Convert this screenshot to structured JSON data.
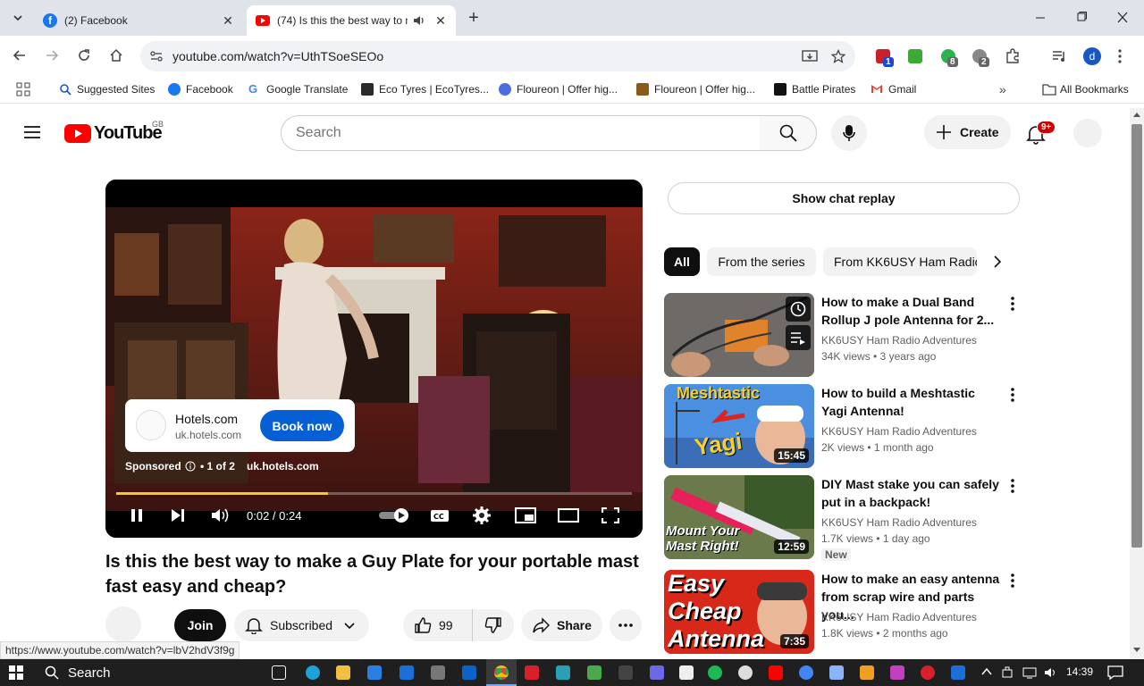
{
  "browser": {
    "tabs": [
      {
        "title": "(2) Facebook",
        "active": false
      },
      {
        "title": "(74) Is this the best way to m",
        "active": true
      }
    ],
    "url": "youtube.com/watch?v=UthTSoeSEOo",
    "extension_badges": [
      "1",
      "8",
      "2"
    ],
    "profile_initial": "d",
    "bookmarks": [
      "Suggested Sites",
      "Facebook",
      "Google Translate",
      "Eco Tyres | EcoTyres...",
      "Floureon | Offer hig...",
      "Floureon | Offer hig...",
      "Battle Pirates",
      "Gmail"
    ],
    "all_bookmarks": "All Bookmarks"
  },
  "yt": {
    "logo_text": "YouTube",
    "region": "GB",
    "search_placeholder": "Search",
    "create_label": "Create",
    "notif_badge": "9+"
  },
  "player": {
    "ad_advertiser": "Hotels.com",
    "ad_domain": "uk.hotels.com",
    "ad_cta": "Book now",
    "sponsored_label": "Sponsored",
    "ad_count": "• 1 of 2",
    "ad_link": "uk.hotels.com",
    "time": "0:02 / 0:24",
    "progress": 0.41
  },
  "video": {
    "title": "Is this the best way to make a Guy Plate for your portable mast fast easy and cheap?",
    "join_label": "Join",
    "subscribed_label": "Subscribed",
    "likes": "99",
    "share_label": "Share"
  },
  "sidebar": {
    "chat_replay": "Show chat replay",
    "chips": [
      "All",
      "From the series",
      "From KK6USY Ham Radio"
    ],
    "recommendations": [
      {
        "title": "How to make a Dual Band Rollup J pole Antenna for 2...",
        "channel": "KK6USY Ham Radio Adventures",
        "meta": "34K views • 3 years ago",
        "duration": "",
        "badge": ""
      },
      {
        "title": "How to build a Meshtastic Yagi Antenna!",
        "channel": "KK6USY Ham Radio Adventures",
        "meta": "2K views • 1 month ago",
        "duration": "15:45",
        "badge": "",
        "thumb_text": [
          "Meshtastic",
          "Yagi"
        ]
      },
      {
        "title": "DIY Mast stake you can safely put in a backpack!",
        "channel": "KK6USY Ham Radio Adventures",
        "meta": "1.7K views • 1 day ago",
        "duration": "12:59",
        "badge": "New",
        "thumb_text": [
          "Mount Your",
          "Mast Right!"
        ]
      },
      {
        "title": "How to make an easy antenna from scrap wire and parts you...",
        "channel": "KK6USY Ham Radio Adventures",
        "meta": "1.8K views • 2 months ago",
        "duration": "7:35",
        "badge": "",
        "thumb_text": [
          "Easy",
          "Cheap",
          "Antenna"
        ]
      }
    ]
  },
  "status_url": "https://www.youtube.com/watch?v=lbV2hdV3f9g",
  "taskbar": {
    "search_label": "Search",
    "clock": "14:39"
  },
  "colors": {
    "yt_red": "#ff0000",
    "cta_blue": "#065fd4",
    "progress_yellow": "#f7c72b",
    "taskbar": "#1f1f1f"
  }
}
